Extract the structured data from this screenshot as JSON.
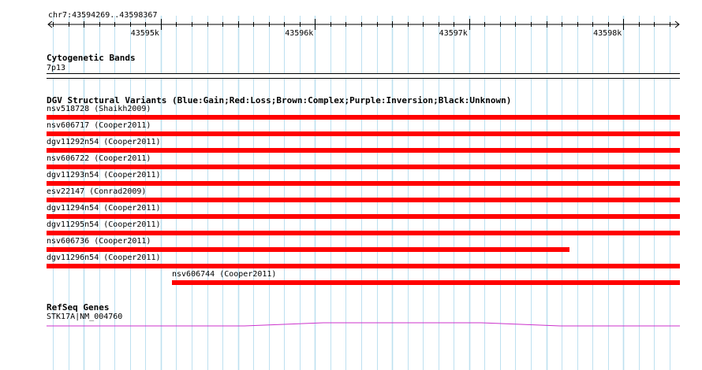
{
  "colors": {
    "grid": "#bde0f0",
    "loss": "#ff0000",
    "gene": "#cc33cc",
    "ruler": "#000000"
  },
  "ruler": {
    "range_label": "chr7:43594269..43598367",
    "start": 43594269,
    "end": 43598367,
    "ticks": [
      {
        "pos": 43595000,
        "label": "43595k"
      },
      {
        "pos": 43596000,
        "label": "43596k"
      },
      {
        "pos": 43597000,
        "label": "43597k"
      },
      {
        "pos": 43598000,
        "label": "43598k"
      }
    ]
  },
  "cytoband": {
    "title": "Cytogenetic Bands",
    "band_label": "7p13"
  },
  "dgv": {
    "title": "DGV Structural Variants (Blue:Gain;Red:Loss;Brown:Complex;Purple:Inversion;Black:Unknown)",
    "variants": [
      {
        "label": "nsv518728 (Shaikh2009)",
        "start": 43594269,
        "end": 43598367,
        "type": "loss"
      },
      {
        "label": "nsv606717 (Cooper2011)",
        "start": 43594269,
        "end": 43598367,
        "type": "loss"
      },
      {
        "label": "dgv11292n54 (Cooper2011)",
        "start": 43594269,
        "end": 43598367,
        "type": "loss"
      },
      {
        "label": "nsv606722 (Cooper2011)",
        "start": 43594269,
        "end": 43598367,
        "type": "loss"
      },
      {
        "label": "dgv11293n54 (Cooper2011)",
        "start": 43594269,
        "end": 43598367,
        "type": "loss"
      },
      {
        "label": "esv22147 (Conrad2009)",
        "start": 43594269,
        "end": 43598367,
        "type": "loss"
      },
      {
        "label": "dgv11294n54 (Cooper2011)",
        "start": 43594269,
        "end": 43598367,
        "type": "loss"
      },
      {
        "label": "dgv11295n54 (Cooper2011)",
        "start": 43594269,
        "end": 43598367,
        "type": "loss"
      },
      {
        "label": "nsv606736 (Cooper2011)",
        "start": 43594269,
        "end": 43597650,
        "type": "loss"
      },
      {
        "label": "dgv11296n54 (Cooper2011)",
        "start": 43594269,
        "end": 43598367,
        "type": "loss"
      },
      {
        "label": "nsv606744 (Cooper2011)",
        "start": 43595070,
        "end": 43598367,
        "type": "loss"
      }
    ]
  },
  "refseq": {
    "title": "RefSeq Genes",
    "gene_label": "STK17A|NM_004760"
  }
}
